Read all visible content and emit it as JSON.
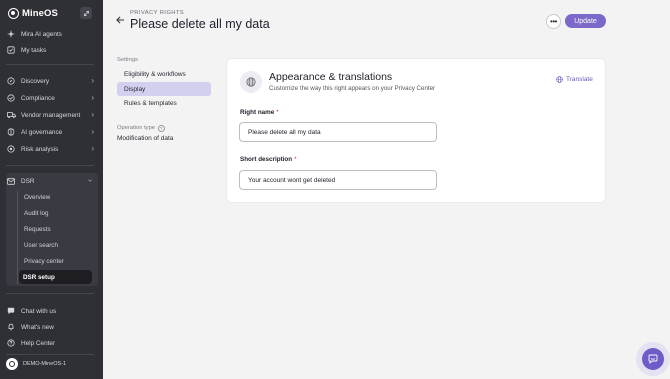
{
  "app": {
    "brand": "MineOS"
  },
  "sidebar": {
    "top_items": [
      {
        "label": "Mira AI agents",
        "icon": "sparkle-icon"
      },
      {
        "label": "My tasks",
        "icon": "task-icon"
      }
    ],
    "sections": [
      {
        "label": "Discovery",
        "icon": "compass-icon"
      },
      {
        "label": "Compliance",
        "icon": "check-circle-icon"
      },
      {
        "label": "Vendor management",
        "icon": "truck-icon"
      },
      {
        "label": "AI governance",
        "icon": "brain-icon"
      },
      {
        "label": "Risk analysis",
        "icon": "risk-icon"
      }
    ],
    "dsr": {
      "label": "DSR",
      "icon": "mail-icon",
      "items": [
        "Overview",
        "Audit log",
        "Requests",
        "User search",
        "Privacy center",
        "DSR setup"
      ],
      "active": "DSR setup"
    },
    "bottom_items": [
      {
        "label": "Chat with us",
        "icon": "chat-icon"
      },
      {
        "label": "What's new",
        "icon": "bell-icon"
      },
      {
        "label": "Help Center",
        "icon": "help-icon"
      }
    ],
    "org": "DEMO-MineOS-1"
  },
  "header": {
    "breadcrumb": "PRIVACY RIGHTS",
    "title": "Please delete all my data",
    "more_label": "•••",
    "update_label": "Update"
  },
  "settings": {
    "label": "Settings",
    "items": [
      "Eligibility & workflows",
      "Display",
      "Rules & templates"
    ],
    "active": "Display",
    "operation_type_label": "Operation type",
    "operation_type_value": "Modification of data"
  },
  "card": {
    "title": "Appearance & translations",
    "subtitle": "Customize the way this right appears on your Privacy Center",
    "translate_label": "Translate",
    "fields": [
      {
        "label": "Right name",
        "required": "*",
        "value": "Please delete all my data"
      },
      {
        "label": "Short description",
        "required": "*",
        "value": "Your account wont get deleted"
      }
    ]
  },
  "colors": {
    "accent": "#7b68c9",
    "sidebar": "#2f2f36",
    "active_setting": "#d2cfef"
  }
}
